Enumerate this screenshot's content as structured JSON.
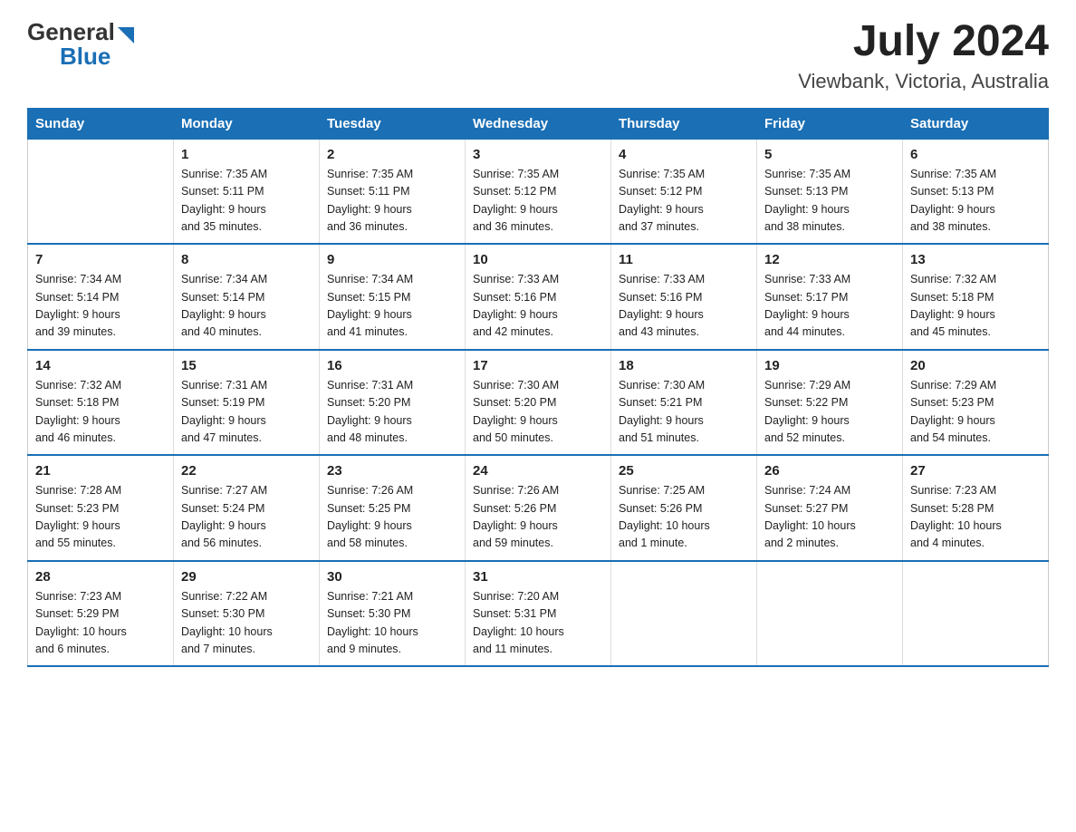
{
  "header": {
    "logo_general": "General",
    "logo_blue": "Blue",
    "title": "July 2024",
    "subtitle": "Viewbank, Victoria, Australia"
  },
  "days_of_week": [
    "Sunday",
    "Monday",
    "Tuesday",
    "Wednesday",
    "Thursday",
    "Friday",
    "Saturday"
  ],
  "weeks": [
    {
      "days": [
        {
          "num": "",
          "info": ""
        },
        {
          "num": "1",
          "info": "Sunrise: 7:35 AM\nSunset: 5:11 PM\nDaylight: 9 hours\nand 35 minutes."
        },
        {
          "num": "2",
          "info": "Sunrise: 7:35 AM\nSunset: 5:11 PM\nDaylight: 9 hours\nand 36 minutes."
        },
        {
          "num": "3",
          "info": "Sunrise: 7:35 AM\nSunset: 5:12 PM\nDaylight: 9 hours\nand 36 minutes."
        },
        {
          "num": "4",
          "info": "Sunrise: 7:35 AM\nSunset: 5:12 PM\nDaylight: 9 hours\nand 37 minutes."
        },
        {
          "num": "5",
          "info": "Sunrise: 7:35 AM\nSunset: 5:13 PM\nDaylight: 9 hours\nand 38 minutes."
        },
        {
          "num": "6",
          "info": "Sunrise: 7:35 AM\nSunset: 5:13 PM\nDaylight: 9 hours\nand 38 minutes."
        }
      ]
    },
    {
      "days": [
        {
          "num": "7",
          "info": "Sunrise: 7:34 AM\nSunset: 5:14 PM\nDaylight: 9 hours\nand 39 minutes."
        },
        {
          "num": "8",
          "info": "Sunrise: 7:34 AM\nSunset: 5:14 PM\nDaylight: 9 hours\nand 40 minutes."
        },
        {
          "num": "9",
          "info": "Sunrise: 7:34 AM\nSunset: 5:15 PM\nDaylight: 9 hours\nand 41 minutes."
        },
        {
          "num": "10",
          "info": "Sunrise: 7:33 AM\nSunset: 5:16 PM\nDaylight: 9 hours\nand 42 minutes."
        },
        {
          "num": "11",
          "info": "Sunrise: 7:33 AM\nSunset: 5:16 PM\nDaylight: 9 hours\nand 43 minutes."
        },
        {
          "num": "12",
          "info": "Sunrise: 7:33 AM\nSunset: 5:17 PM\nDaylight: 9 hours\nand 44 minutes."
        },
        {
          "num": "13",
          "info": "Sunrise: 7:32 AM\nSunset: 5:18 PM\nDaylight: 9 hours\nand 45 minutes."
        }
      ]
    },
    {
      "days": [
        {
          "num": "14",
          "info": "Sunrise: 7:32 AM\nSunset: 5:18 PM\nDaylight: 9 hours\nand 46 minutes."
        },
        {
          "num": "15",
          "info": "Sunrise: 7:31 AM\nSunset: 5:19 PM\nDaylight: 9 hours\nand 47 minutes."
        },
        {
          "num": "16",
          "info": "Sunrise: 7:31 AM\nSunset: 5:20 PM\nDaylight: 9 hours\nand 48 minutes."
        },
        {
          "num": "17",
          "info": "Sunrise: 7:30 AM\nSunset: 5:20 PM\nDaylight: 9 hours\nand 50 minutes."
        },
        {
          "num": "18",
          "info": "Sunrise: 7:30 AM\nSunset: 5:21 PM\nDaylight: 9 hours\nand 51 minutes."
        },
        {
          "num": "19",
          "info": "Sunrise: 7:29 AM\nSunset: 5:22 PM\nDaylight: 9 hours\nand 52 minutes."
        },
        {
          "num": "20",
          "info": "Sunrise: 7:29 AM\nSunset: 5:23 PM\nDaylight: 9 hours\nand 54 minutes."
        }
      ]
    },
    {
      "days": [
        {
          "num": "21",
          "info": "Sunrise: 7:28 AM\nSunset: 5:23 PM\nDaylight: 9 hours\nand 55 minutes."
        },
        {
          "num": "22",
          "info": "Sunrise: 7:27 AM\nSunset: 5:24 PM\nDaylight: 9 hours\nand 56 minutes."
        },
        {
          "num": "23",
          "info": "Sunrise: 7:26 AM\nSunset: 5:25 PM\nDaylight: 9 hours\nand 58 minutes."
        },
        {
          "num": "24",
          "info": "Sunrise: 7:26 AM\nSunset: 5:26 PM\nDaylight: 9 hours\nand 59 minutes."
        },
        {
          "num": "25",
          "info": "Sunrise: 7:25 AM\nSunset: 5:26 PM\nDaylight: 10 hours\nand 1 minute."
        },
        {
          "num": "26",
          "info": "Sunrise: 7:24 AM\nSunset: 5:27 PM\nDaylight: 10 hours\nand 2 minutes."
        },
        {
          "num": "27",
          "info": "Sunrise: 7:23 AM\nSunset: 5:28 PM\nDaylight: 10 hours\nand 4 minutes."
        }
      ]
    },
    {
      "days": [
        {
          "num": "28",
          "info": "Sunrise: 7:23 AM\nSunset: 5:29 PM\nDaylight: 10 hours\nand 6 minutes."
        },
        {
          "num": "29",
          "info": "Sunrise: 7:22 AM\nSunset: 5:30 PM\nDaylight: 10 hours\nand 7 minutes."
        },
        {
          "num": "30",
          "info": "Sunrise: 7:21 AM\nSunset: 5:30 PM\nDaylight: 10 hours\nand 9 minutes."
        },
        {
          "num": "31",
          "info": "Sunrise: 7:20 AM\nSunset: 5:31 PM\nDaylight: 10 hours\nand 11 minutes."
        },
        {
          "num": "",
          "info": ""
        },
        {
          "num": "",
          "info": ""
        },
        {
          "num": "",
          "info": ""
        }
      ]
    }
  ]
}
